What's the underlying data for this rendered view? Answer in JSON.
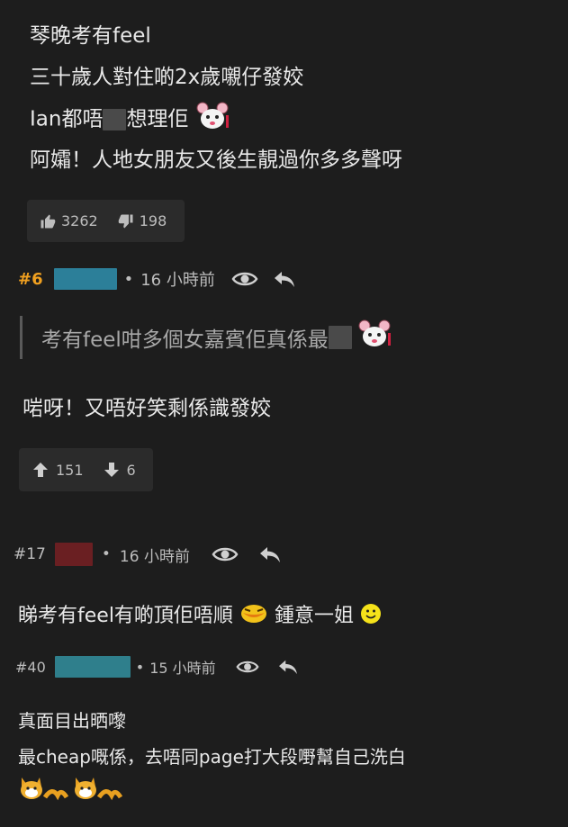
{
  "post5": {
    "lines": [
      "琴晚考有feel",
      "三十歲人對住啲2x歲嚫仔發姣",
      "Ian都唔",
      "想理佢",
      "阿孀！人地女朋友又後生靚過你多多聲呀"
    ],
    "likes": "3262",
    "dislikes": "198"
  },
  "post6": {
    "number": "#6",
    "time": "16 小時前",
    "quote_before": "考有feel咁多個女嘉賓佢真係最",
    "body": "啱呀！又唔好笑剩係識發姣",
    "upvotes": "151",
    "downvotes": "6"
  },
  "post17": {
    "number": "#17",
    "time": "16 小時前",
    "body_part1": "睇考有feel有啲頂佢唔順",
    "body_part2": "鍾意一姐"
  },
  "post40": {
    "number": "#40",
    "time": "15 小時前",
    "line1": "真面目出晒嚟",
    "line2": "最cheap嘅係，去唔同page打大段嘢幫自己洗白"
  },
  "colors": {
    "background": "#1d1d1d",
    "accent_post_number": "#f0a020",
    "blur_blue": "#2c7f99",
    "blur_red": "#6a1f22",
    "blur_teal": "#2f7f8c"
  },
  "icons": [
    "thumbs-up-icon",
    "thumbs-down-icon",
    "eye-icon",
    "reply-icon",
    "arrow-up-icon",
    "arrow-down-icon",
    "mouse-sticker",
    "duck-sticker",
    "smiley-icon",
    "cat-sticker"
  ]
}
